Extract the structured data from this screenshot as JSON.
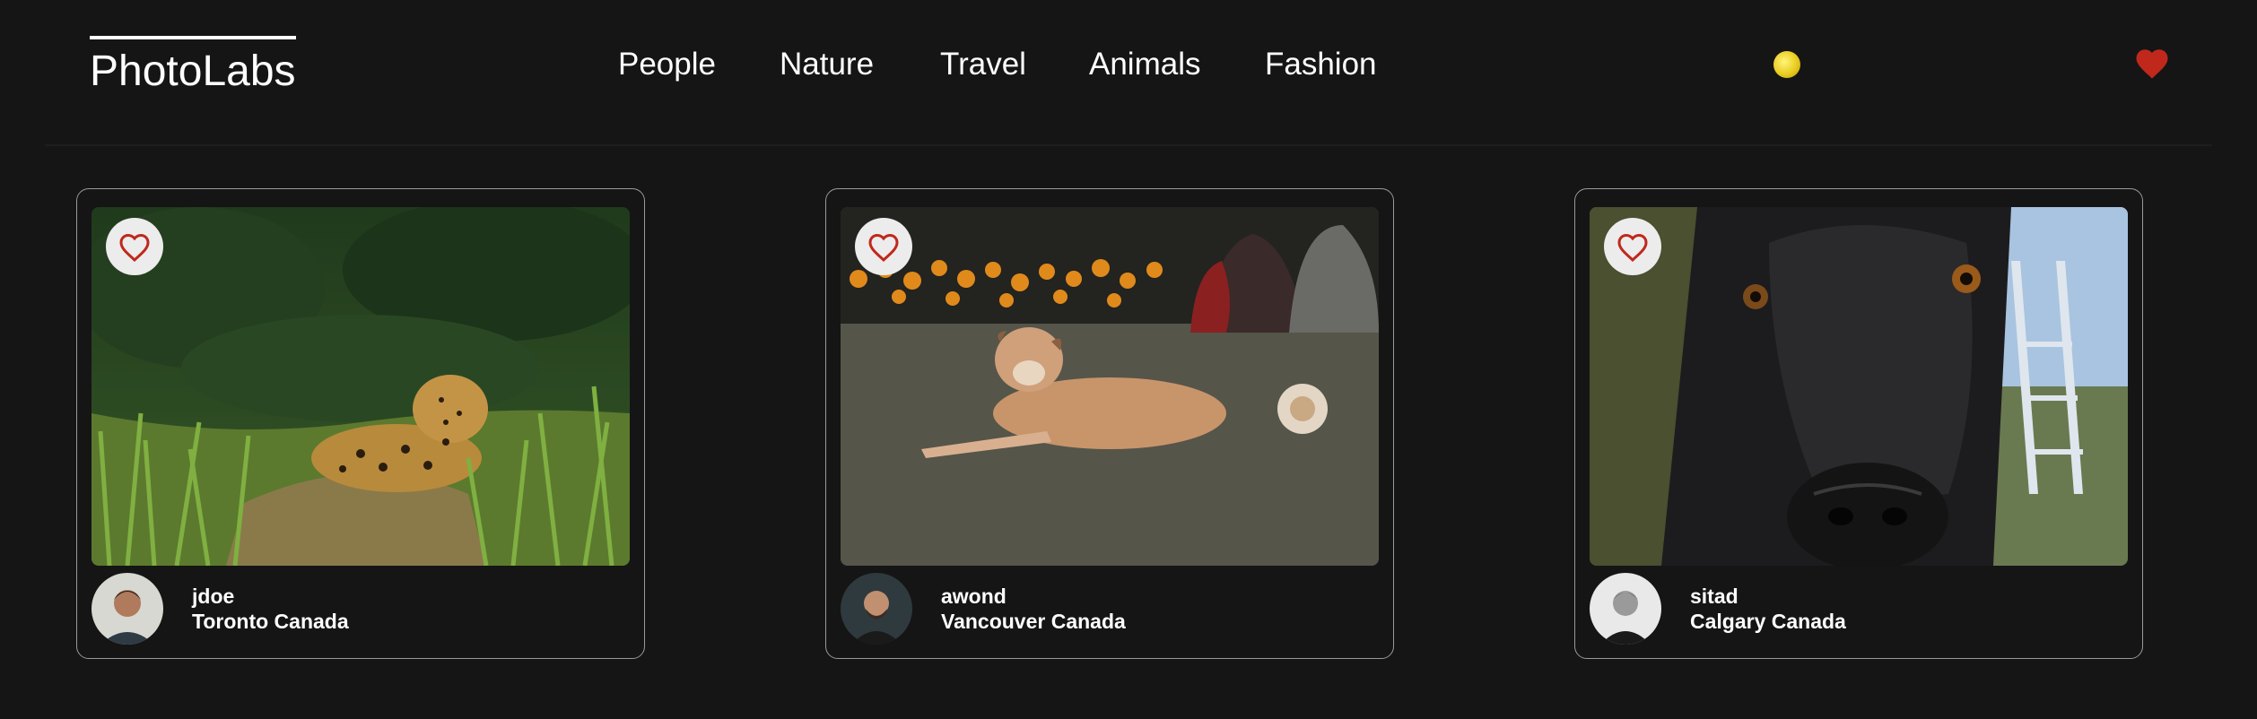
{
  "app": {
    "logo": "PhotoLabs"
  },
  "nav": {
    "items": [
      "People",
      "Nature",
      "Travel",
      "Animals",
      "Fashion"
    ]
  },
  "header": {
    "notification_icon": "light-bulb-icon",
    "favorites_icon": "heart-icon",
    "favorites_color": "#c0281c"
  },
  "photos": [
    {
      "username": "jdoe",
      "location": "Toronto Canada",
      "subject": "jaguar-in-grass"
    },
    {
      "username": "awond",
      "location": "Vancouver Canada",
      "subject": "dog-lying-on-grass"
    },
    {
      "username": "sitad",
      "location": "Calgary Canada",
      "subject": "black-dog-closeup"
    }
  ],
  "colors": {
    "background": "#151515",
    "accent": "#c0281c",
    "bulb": "#e9cc1f"
  }
}
